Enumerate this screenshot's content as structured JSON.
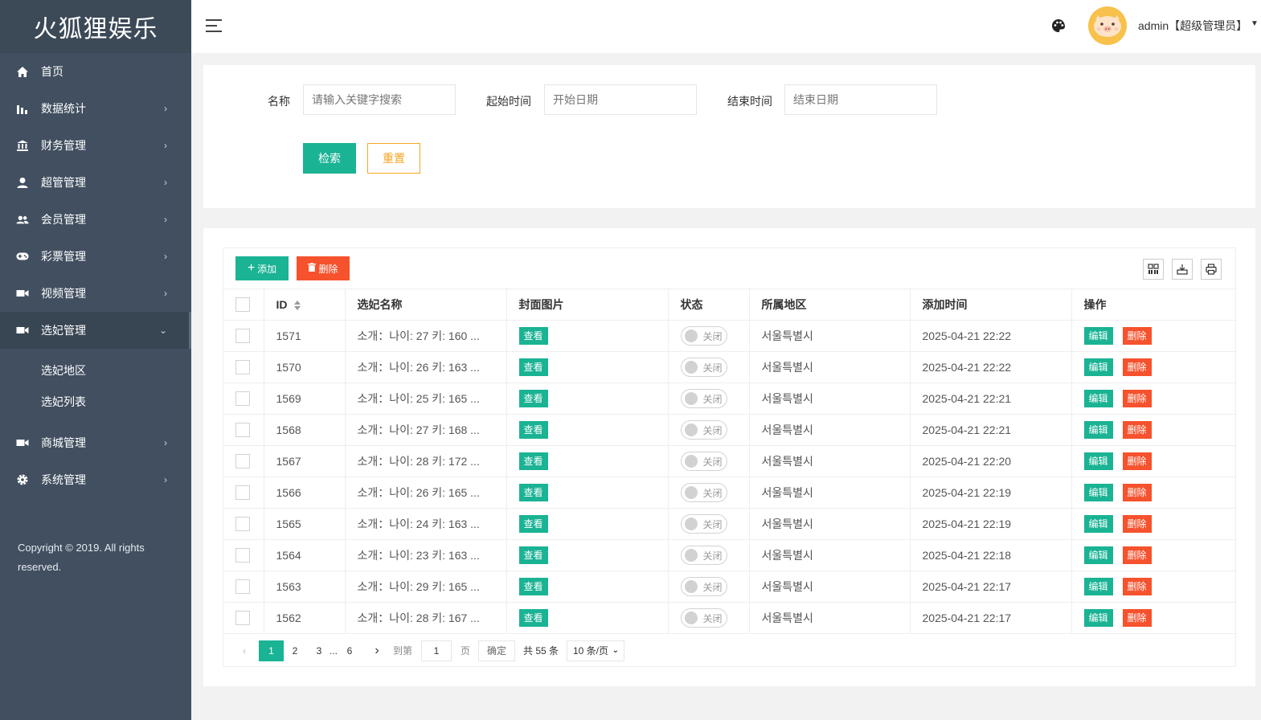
{
  "brand": {
    "title": "火狐狸娱乐"
  },
  "sidebar": {
    "items": [
      {
        "label": "首页",
        "icon": "home-icon"
      },
      {
        "label": "数据统计",
        "icon": "bar-chart-icon"
      },
      {
        "label": "财务管理",
        "icon": "bank-icon"
      },
      {
        "label": "超管管理",
        "icon": "user-icon"
      },
      {
        "label": "会员管理",
        "icon": "users-icon"
      },
      {
        "label": "彩票管理",
        "icon": "gamepad-icon"
      },
      {
        "label": "视频管理",
        "icon": "video-icon"
      },
      {
        "label": "选妃管理",
        "icon": "video-icon",
        "expanded": true
      },
      {
        "label": "商城管理",
        "icon": "video-icon"
      },
      {
        "label": "系统管理",
        "icon": "gear-icon"
      }
    ],
    "subitems": [
      "选妃地区",
      "选妃列表"
    ],
    "copyright": "Copyright © 2019. All rights reserved."
  },
  "header": {
    "user": "admin【超级管理员】"
  },
  "search": {
    "name_label": "名称",
    "name_placeholder": "请输入关键字搜索",
    "start_label": "起始时间",
    "start_placeholder": "开始日期",
    "end_label": "结束时间",
    "end_placeholder": "结束日期",
    "search_button": "检索",
    "reset_button": "重置"
  },
  "toolbar": {
    "add_button": "添加",
    "delete_button": "删除"
  },
  "table": {
    "columns": [
      "ID",
      "选妃名称",
      "封面图片",
      "状态",
      "所属地区",
      "添加时间",
      "操作"
    ],
    "view_label": "查看",
    "switch_label": "关闭",
    "edit_label": "编辑",
    "delete_label": "删除",
    "rows": [
      {
        "id": "1571",
        "name": "소개：나이: 27 키: 160 ...",
        "region": "서울특별시",
        "time": "2025-04-21 22:22"
      },
      {
        "id": "1570",
        "name": "소개：나이: 26 키: 163 ...",
        "region": "서울특별시",
        "time": "2025-04-21 22:22"
      },
      {
        "id": "1569",
        "name": "소개：나이: 25 키: 165 ...",
        "region": "서울특별시",
        "time": "2025-04-21 22:21"
      },
      {
        "id": "1568",
        "name": "소개：나이: 27 키: 168 ...",
        "region": "서울특별시",
        "time": "2025-04-21 22:21"
      },
      {
        "id": "1567",
        "name": "소개：나이: 28 키: 172 ...",
        "region": "서울특별시",
        "time": "2025-04-21 22:20"
      },
      {
        "id": "1566",
        "name": "소개：나이: 26 키: 165 ...",
        "region": "서울특별시",
        "time": "2025-04-21 22:19"
      },
      {
        "id": "1565",
        "name": "소개：나이: 24 키: 163 ...",
        "region": "서울특별시",
        "time": "2025-04-21 22:19"
      },
      {
        "id": "1564",
        "name": "소개：나이: 23 키: 163 ...",
        "region": "서울특별시",
        "time": "2025-04-21 22:18"
      },
      {
        "id": "1563",
        "name": "소개：나이: 29 키: 165 ...",
        "region": "서울특별시",
        "time": "2025-04-21 22:17"
      },
      {
        "id": "1562",
        "name": "소개：나이: 28 키: 167 ...",
        "region": "서울특별시",
        "time": "2025-04-21 22:17"
      }
    ]
  },
  "pagination": {
    "pages": [
      "1",
      "2",
      "3",
      "...",
      "6"
    ],
    "current": "1",
    "goto_label": "到第",
    "goto_value": "1",
    "page_suffix": "页",
    "confirm": "确定",
    "total": "共 55 条",
    "per_page": "10 条/页"
  },
  "colors": {
    "accent": "#1ab394",
    "danger": "#f5522d",
    "warning": "#f5a623",
    "sidebar": "#414f60"
  }
}
